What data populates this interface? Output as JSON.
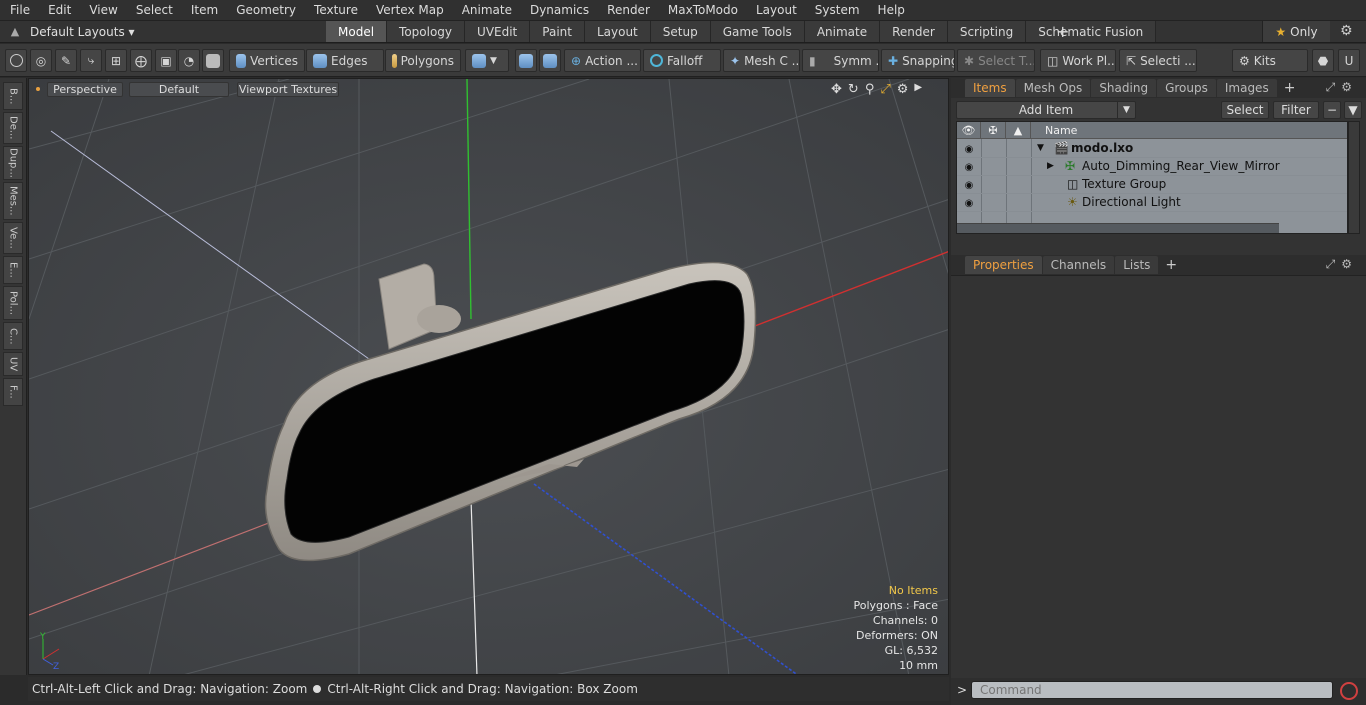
{
  "menu": [
    "File",
    "Edit",
    "View",
    "Select",
    "Item",
    "Geometry",
    "Texture",
    "Vertex Map",
    "Animate",
    "Dynamics",
    "Render",
    "MaxToModo",
    "Layout",
    "System",
    "Help"
  ],
  "layout_selector": "Default Layouts ▾",
  "layout_tabs": [
    "Model",
    "Topology",
    "UVEdit",
    "Paint",
    "Layout",
    "Setup",
    "Game Tools",
    "Animate",
    "Render",
    "Scripting",
    "Schematic Fusion"
  ],
  "active_layout_tab": "Model",
  "only_label": "Only",
  "toolbar": {
    "vertices": "Vertices",
    "edges": "Edges",
    "polygons": "Polygons",
    "action": "Action ...",
    "falloff": "Falloff",
    "mesh_c": "Mesh C ...",
    "symm": "Symm ...",
    "snapping": "Snapping",
    "select_t": "Select T...",
    "work_pl": "Work Pl...",
    "selecti": "Selecti ...",
    "kits": "Kits"
  },
  "left_strip": [
    "B...",
    "De...",
    "Dup...",
    "Mes...",
    "Ve...",
    "E...",
    "Pol...",
    "C...",
    "UV",
    "F..."
  ],
  "viewport": {
    "view_mode": "Perspective",
    "style": "Default",
    "textures": "Viewport Textures",
    "info": {
      "selection": "No Items",
      "polygons": "Polygons : Face",
      "channels": "Channels: 0",
      "deformers": "Deformers: ON",
      "gl": "GL: 6,532",
      "scale": "10 mm"
    },
    "axis_y": "Y",
    "axis_z": "Z"
  },
  "status": {
    "left": "Ctrl-Alt-Left Click and Drag: Navigation: Zoom",
    "right": "Ctrl-Alt-Right Click and Drag: Navigation: Box Zoom"
  },
  "items_panel": {
    "tabs": [
      "Items",
      "Mesh Ops",
      "Shading",
      "Groups",
      "Images"
    ],
    "active_tab": "Items",
    "add_item": "Add Item",
    "select": "Select",
    "filter": "Filter",
    "column_name": "Name",
    "tree": [
      {
        "label": "modo.lxo",
        "bold": true
      },
      {
        "label": "Auto_Dimming_Rear_View_Mirror",
        "bold": false
      },
      {
        "label": "Texture Group",
        "bold": false
      },
      {
        "label": "Directional Light",
        "bold": false
      }
    ]
  },
  "props_panel": {
    "tabs": [
      "Properties",
      "Channels",
      "Lists"
    ],
    "active_tab": "Properties"
  },
  "command": {
    "prompt": ">",
    "placeholder": "Command"
  },
  "colors": {
    "accent": "#f0a040",
    "axis_x": "#d03030",
    "axis_y": "#30c030",
    "axis_z": "#3050d0"
  }
}
